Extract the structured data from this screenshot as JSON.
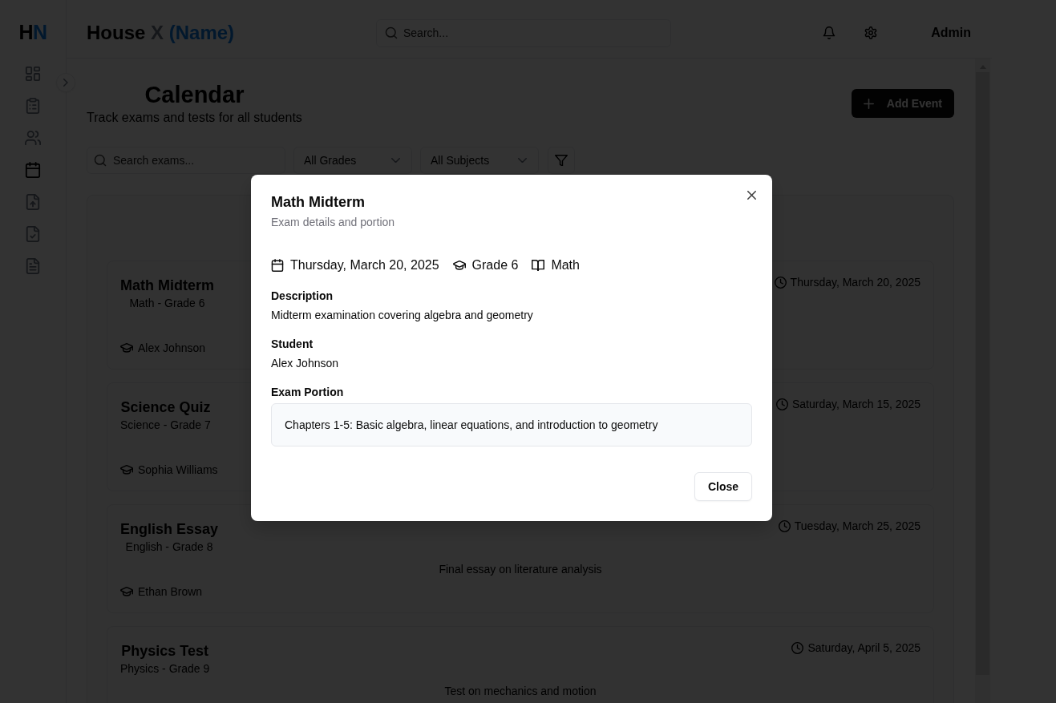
{
  "sidebar": {
    "logo_parts": [
      {
        "text": "H",
        "kind": "dark"
      },
      {
        "text": "N",
        "kind": "accent"
      }
    ],
    "items": [
      {
        "selected": false
      },
      {
        "selected": false
      },
      {
        "selected": false
      },
      {
        "selected": true
      },
      {
        "selected": false
      },
      {
        "selected": false
      },
      {
        "selected": false
      }
    ]
  },
  "header": {
    "title_parts": [
      {
        "text": "House",
        "kind": "dark"
      },
      {
        "text": "X",
        "kind": "muted"
      },
      {
        "text": "(Name)",
        "kind": "accent"
      }
    ],
    "search": {
      "placeholder": "Search..."
    },
    "user": "Admin"
  },
  "page": {
    "title": "Calendar",
    "subtitle": "Track exams and tests for all students",
    "add_button": "Add Event"
  },
  "filters": {
    "search": {
      "placeholder": "Search exams..."
    },
    "grade": "All Grades",
    "subject": "All Subjects"
  },
  "exams": [
    {
      "title": "Math Midterm",
      "subtitle": "Math - Grade 6",
      "date": "Thursday, March 20, 2025",
      "student": "Alex Johnson"
    },
    {
      "title": "Science Quiz",
      "subtitle": "Science - Grade 7",
      "date": "Saturday, March 15, 2025",
      "student": "Sophia Williams"
    },
    {
      "title": "English Essay",
      "subtitle": "English - Grade 8",
      "date": "Tuesday, March 25, 2025",
      "description": "Final essay on literature analysis",
      "student": "Ethan Brown"
    },
    {
      "title": "Physics Test",
      "subtitle": "Physics - Grade 9",
      "date": "Saturday, April 5, 2025",
      "description": "Test on mechanics and motion"
    }
  ],
  "modal": {
    "title": "Math Midterm",
    "subtitle": "Exam details and portion",
    "meta": [
      {
        "kind": "date",
        "text": "Thursday, March 20, 2025"
      },
      {
        "kind": "grade",
        "text": "Grade 6"
      },
      {
        "kind": "subject",
        "text": "Math"
      }
    ],
    "sections": [
      {
        "kind": "plain",
        "heading": "Description",
        "text": "Midterm examination covering algebra and geometry"
      },
      {
        "kind": "plain",
        "heading": "Student",
        "text": "Alex Johnson"
      },
      {
        "kind": "boxed",
        "heading": "Exam Portion",
        "text": "Chapters 1-5: Basic algebra, linear equations, and introduction to geometry"
      }
    ],
    "close_button": "Close"
  }
}
